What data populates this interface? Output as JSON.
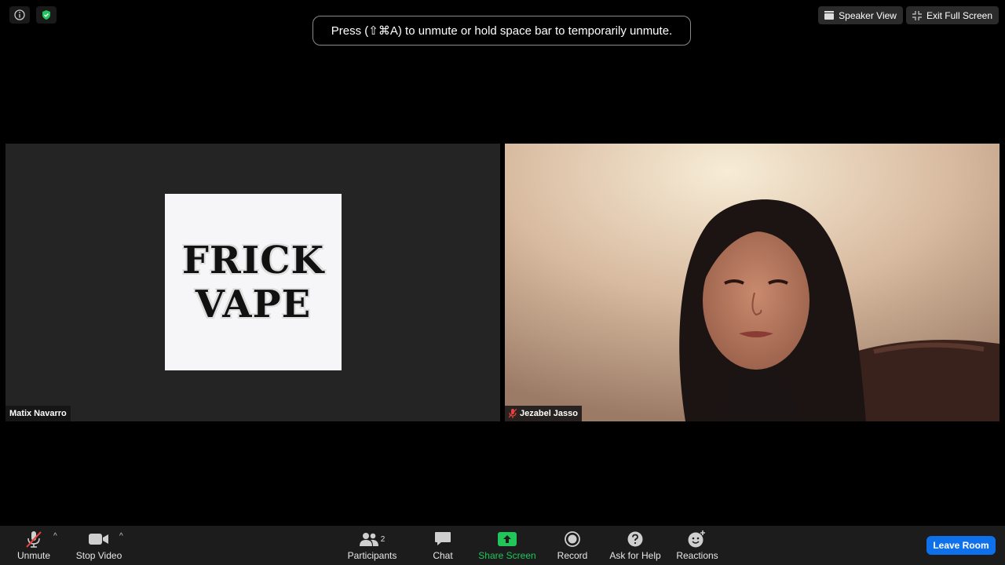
{
  "banner": {
    "text": "Press  (⇧⌘A) to unmute or hold space bar to temporarily unmute."
  },
  "top_right": {
    "speaker_view": "Speaker View",
    "exit_full_screen": "Exit Full Screen"
  },
  "tiles": [
    {
      "name": "Matix Navarro",
      "avatar_text_line1": "FRICK",
      "avatar_text_line2": "VAPE"
    },
    {
      "name": "Jezabel Jasso",
      "muted": true
    }
  ],
  "toolbar": {
    "unmute": "Unmute",
    "stop_video": "Stop Video",
    "participants": "Participants",
    "participants_count": "2",
    "chat": "Chat",
    "share_screen": "Share Screen",
    "record": "Record",
    "ask_for_help": "Ask for Help",
    "reactions": "Reactions",
    "leave_room": "Leave Room"
  },
  "colors": {
    "share_green": "#21c55a",
    "leave_blue": "#0e71eb",
    "muted_red": "#e5413c",
    "shield_green": "#23c45e"
  }
}
